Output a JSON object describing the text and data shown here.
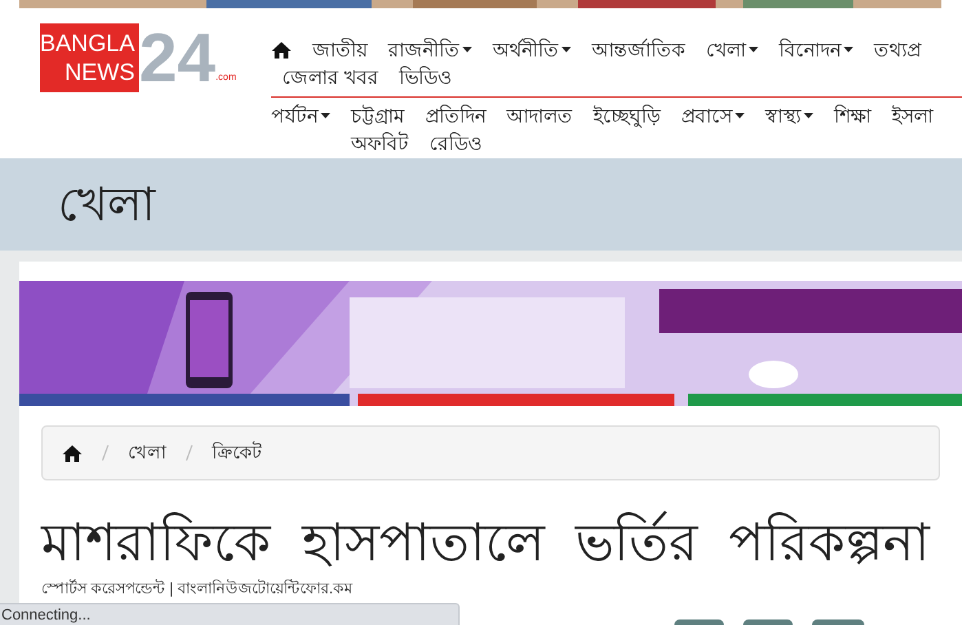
{
  "logo": {
    "line_1": "BANGLA",
    "line_2": "NEWS",
    "number": "24",
    "suffix": ".com"
  },
  "nav_top": [
    [
      {
        "label": "জাতীয়",
        "dropdown": false
      },
      {
        "label": "রাজনীতি",
        "dropdown": true
      },
      {
        "label": "অর্থনীতি",
        "dropdown": true
      },
      {
        "label": "আন্তর্জাতিক",
        "dropdown": false
      },
      {
        "label": "খেলা",
        "dropdown": true
      },
      {
        "label": "বিনোদন",
        "dropdown": true
      },
      {
        "label": "তথ্যপ্র",
        "dropdown": false
      }
    ],
    [
      {
        "label": "জেলার খবর",
        "dropdown": false
      },
      {
        "label": "ভিডিও",
        "dropdown": false
      }
    ]
  ],
  "nav_bottom": [
    [
      {
        "label": "পর্যটন",
        "dropdown": true
      },
      {
        "label": "চট্টগ্রাম",
        "dropdown": false
      },
      {
        "label": "প্রতিদিন",
        "dropdown": false
      },
      {
        "label": "আদালত",
        "dropdown": false
      },
      {
        "label": "ইচ্ছেঘুড়ি",
        "dropdown": false
      },
      {
        "label": "প্রবাসে",
        "dropdown": true
      },
      {
        "label": "স্বাস্থ্য",
        "dropdown": true
      },
      {
        "label": "শিক্ষা",
        "dropdown": false
      },
      {
        "label": "ইসলা",
        "dropdown": false
      }
    ],
    [
      {
        "label": "অফবিট",
        "dropdown": false
      },
      {
        "label": "রেডিও",
        "dropdown": false
      }
    ]
  ],
  "section_title": "খেলা",
  "breadcrumb": [
    "খেলা",
    "ক্রিকেট"
  ],
  "headline": "মাশরাফিকে হাসপাতালে ভর্তির পরিকল্পনা",
  "byline": "স্পোর্টস করেসপন্ডেন্ট | বাংলানিউজটোয়েন্টিফোর.কম",
  "status_bar": "Connecting..."
}
